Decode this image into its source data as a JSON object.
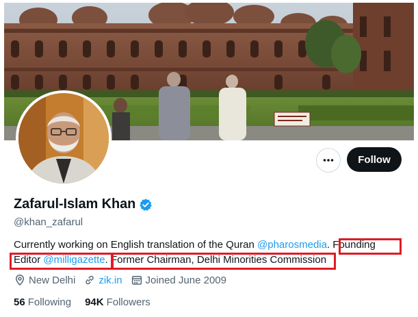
{
  "profile": {
    "display_name": "Zafarul-Islam Khan",
    "handle": "@khan_zafarul",
    "verified": true
  },
  "actions": {
    "more_icon": "more-horizontal-icon",
    "follow_label": "Follow"
  },
  "bio": {
    "part1": "Currently working on English translation of the Quran ",
    "mention1": "@pharosmedia",
    "part2": ". Founding",
    "part3": "Editor ",
    "mention2": "@milligazette",
    "part4": ". Former Chairman, Delhi Minorities Commission"
  },
  "meta": {
    "location": "New Delhi",
    "website": "zik.in",
    "joined": "Joined June 2009"
  },
  "stats": {
    "following_count": "56",
    "following_label": "Following",
    "followers_count": "94K",
    "followers_label": "Followers"
  },
  "colors": {
    "accent": "#1d9bf0",
    "follow_button_bg": "#0f1419",
    "annotation_red": "#e01b24",
    "secondary_text": "#536471"
  }
}
